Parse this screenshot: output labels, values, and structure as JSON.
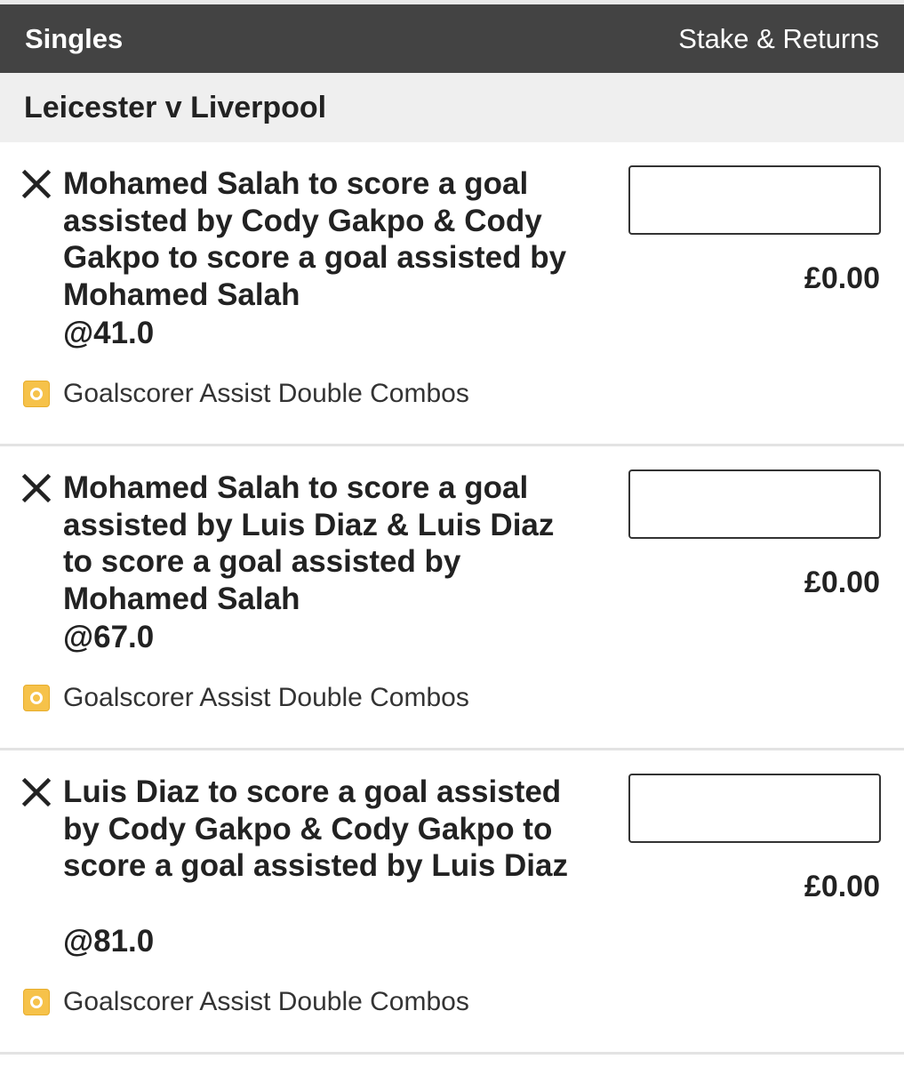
{
  "header": {
    "title": "Singles",
    "right_label": "Stake & Returns"
  },
  "event": {
    "title": "Leicester v Liverpool"
  },
  "bets": [
    {
      "selection": "Mohamed Salah to score a goal assisted by Cody Gakpo & Cody Gakpo to score a goal assisted by Mohamed Salah",
      "odds": "@41.0",
      "market": "Goalscorer Assist Double Combos",
      "stake": "",
      "returns": "£0.00"
    },
    {
      "selection": "Mohamed Salah to score a goal assisted by Luis Diaz & Luis Diaz to score a goal assisted by Mohamed Salah",
      "odds": "@67.0",
      "market": "Goalscorer Assist Double Combos",
      "stake": "",
      "returns": "£0.00"
    },
    {
      "selection": "Luis Diaz to score a goal assisted by Cody Gakpo & Cody Gakpo to score a goal assisted by Luis Diaz",
      "odds": "@81.0",
      "market": "Goalscorer Assist Double Combos",
      "stake": "",
      "returns": "£0.00"
    }
  ],
  "colors": {
    "header_bg": "#434343",
    "event_bg": "#efefef",
    "market_icon": "#f6c24a"
  }
}
